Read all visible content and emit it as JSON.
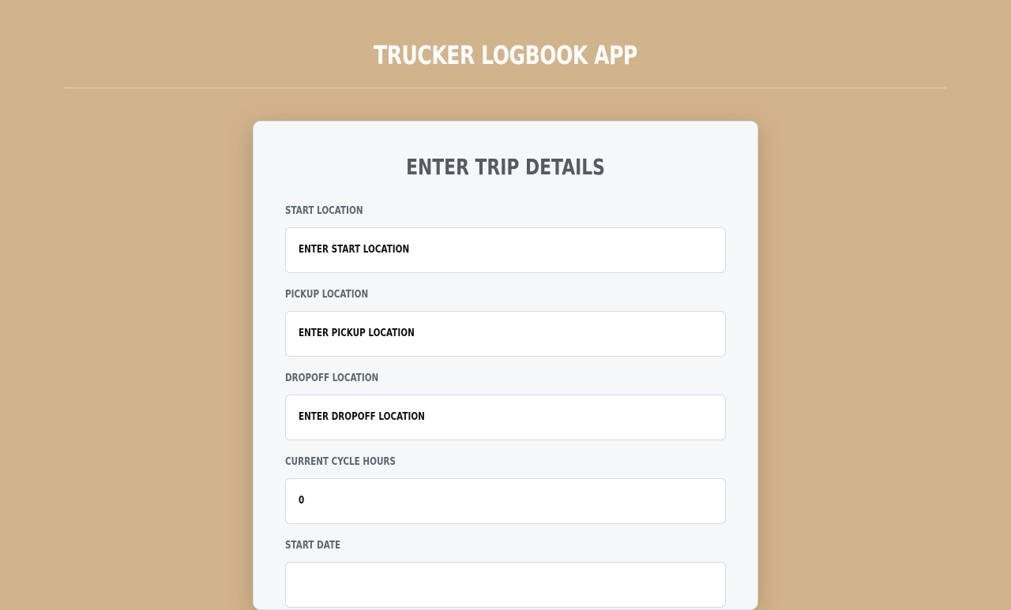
{
  "app": {
    "title": "TRUCKER LOGBOOK APP"
  },
  "form": {
    "title": "ENTER TRIP DETAILS",
    "fields": [
      {
        "label": "START LOCATION",
        "placeholder": "ENTER START LOCATION",
        "value": ""
      },
      {
        "label": "PICKUP LOCATION",
        "placeholder": "ENTER PICKUP LOCATION",
        "value": ""
      },
      {
        "label": "DROPOFF LOCATION",
        "placeholder": "ENTER DROPOFF LOCATION",
        "value": ""
      },
      {
        "label": "CURRENT CYCLE HOURS",
        "placeholder": "",
        "value": "0"
      },
      {
        "label": "START DATE",
        "placeholder": "",
        "value": ""
      }
    ]
  },
  "colors": {
    "background": "#d2b48c",
    "card": "#f6f7f9",
    "title_text": "#ffffff",
    "label_text": "#5d6770"
  }
}
